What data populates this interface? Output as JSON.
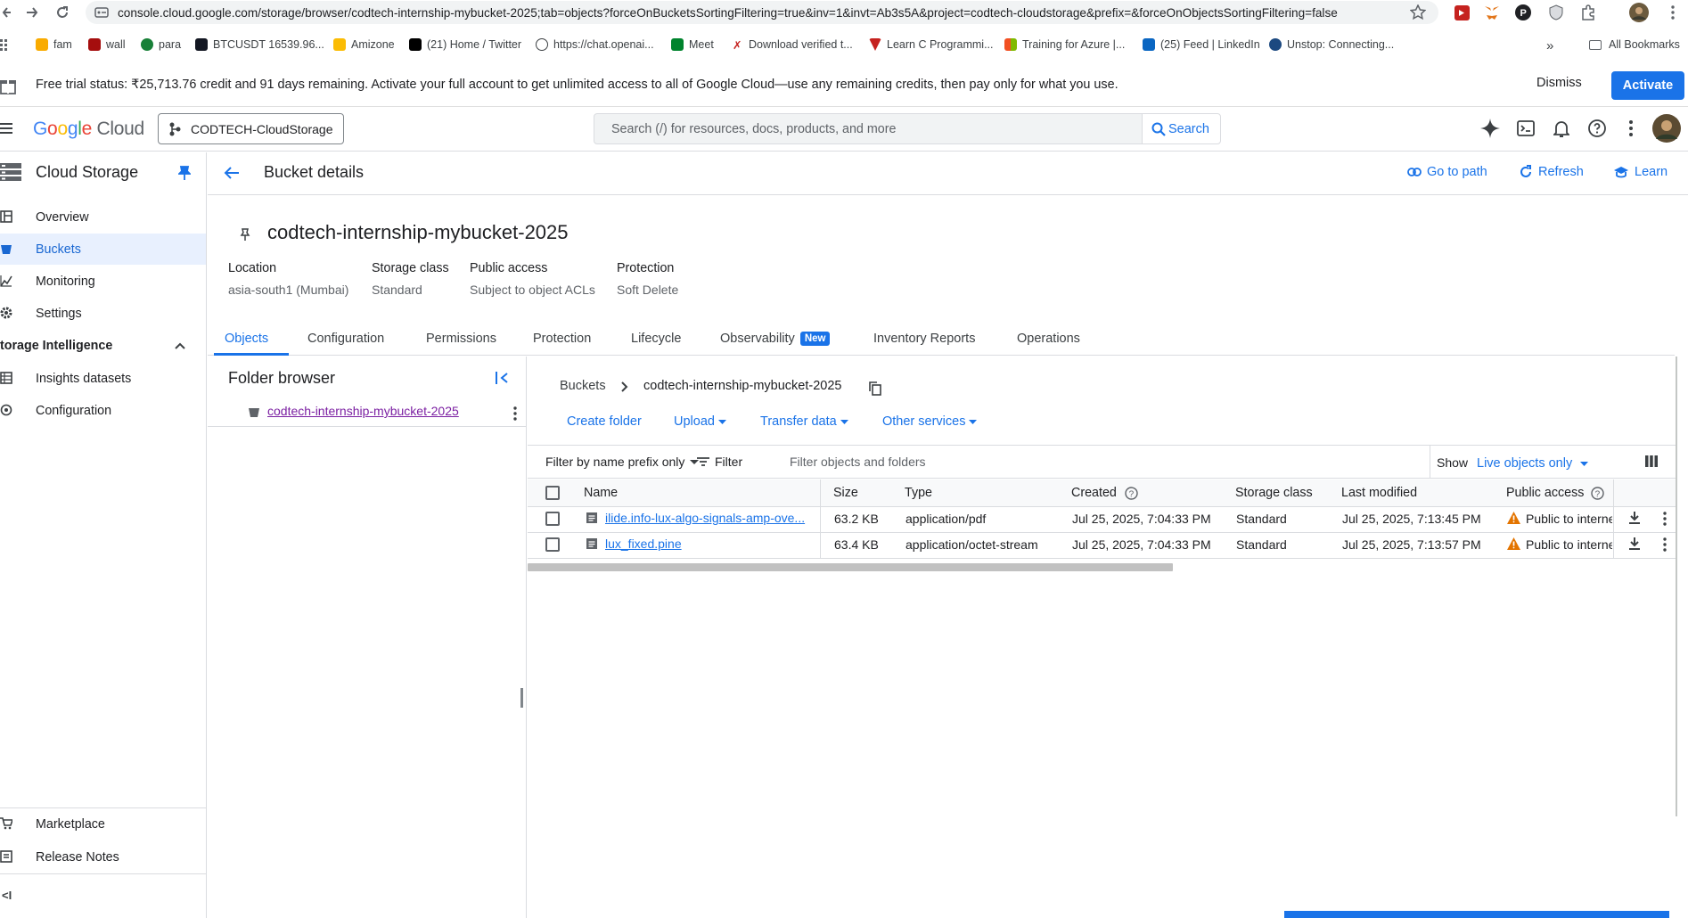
{
  "browser": {
    "url": "console.cloud.google.com/storage/browser/codtech-internship-mybucket-2025;tab=objects?forceOnBucketsSortingFiltering=true&inv=1&invt=Ab3s5A&project=codtech-cloudstorage&prefix=&forceOnObjectsSortingFiltering=false",
    "bookmarks": [
      "fam",
      "wall",
      "para",
      "BTCUSDT 16539.96...",
      "Amizone",
      "(21) Home / Twitter",
      "https://chat.openai...",
      "Meet",
      "Download verified t...",
      "Learn C Programmi...",
      "Training for Azure |...",
      "(25) Feed | LinkedIn",
      "Unstop: Connecting..."
    ],
    "all_bookmarks": "All Bookmarks",
    "more_chevron": "»"
  },
  "banner": {
    "text": "Free trial status: ₹25,713.76 credit and 91 days remaining. Activate your full account to get unlimited access to all of Google Cloud—use any remaining credits, then pay only for what you use.",
    "dismiss": "Dismiss",
    "activate": "Activate"
  },
  "header": {
    "logo_google": "Google",
    "logo_cloud": "Cloud",
    "project": "CODTECH-CloudStorage",
    "search_placeholder": "Search (/) for resources, docs, products, and more",
    "search_button": "Search"
  },
  "sidebar": {
    "title": "Cloud Storage",
    "items": [
      {
        "label": "Overview",
        "icon": "dashboard-icon"
      },
      {
        "label": "Buckets",
        "icon": "bucket-icon"
      },
      {
        "label": "Monitoring",
        "icon": "chart-icon"
      },
      {
        "label": "Settings",
        "icon": "gear-icon"
      }
    ],
    "section_title": "torage Intelligence",
    "section_items": [
      {
        "label": "Insights datasets",
        "icon": "dataset-icon"
      },
      {
        "label": "Configuration",
        "icon": "config-icon"
      }
    ],
    "bottom_items": [
      {
        "label": "Marketplace",
        "icon": "cart-icon"
      },
      {
        "label": "Release Notes",
        "icon": "notes-icon"
      }
    ],
    "collapse": "<I"
  },
  "page": {
    "title": "Bucket details",
    "go_to_path": "Go to path",
    "refresh": "Refresh",
    "learn": "Learn",
    "bucket_name": "codtech-internship-mybucket-2025",
    "meta": [
      {
        "key": "Location",
        "value": "asia-south1 (Mumbai)"
      },
      {
        "key": "Storage class",
        "value": "Standard"
      },
      {
        "key": "Public access",
        "value": "Subject to object ACLs"
      },
      {
        "key": "Protection",
        "value": "Soft Delete"
      }
    ],
    "tabs": [
      "Objects",
      "Configuration",
      "Permissions",
      "Protection",
      "Lifecycle",
      "Observability",
      "Inventory Reports",
      "Operations"
    ],
    "new_badge": "New",
    "active_tab": "Objects"
  },
  "folder_browser": {
    "title": "Folder browser",
    "bucket": "codtech-internship-mybucket-2025"
  },
  "objects": {
    "breadcrumb_root": "Buckets",
    "breadcrumb_current": "codtech-internship-mybucket-2025",
    "actions": [
      "Create folder",
      "Upload",
      "Transfer data",
      "Other services"
    ],
    "filter_mode": "Filter by name prefix only",
    "filter_label": "Filter",
    "filter_placeholder": "Filter objects and folders",
    "show_label": "Show",
    "show_value": "Live objects only",
    "columns": [
      "Name",
      "Size",
      "Type",
      "Created",
      "Storage class",
      "Last modified",
      "Public access"
    ],
    "rows": [
      {
        "name": "ilide.info-lux-algo-signals-amp-ove...",
        "size": "63.2 KB",
        "type": "application/pdf",
        "created": "Jul 25, 2025, 7:04:33 PM",
        "storage_class": "Standard",
        "last_modified": "Jul 25, 2025, 7:13:45 PM",
        "public_access": "Public to interne"
      },
      {
        "name": "lux_fixed.pine",
        "size": "63.4 KB",
        "type": "application/octet-stream",
        "created": "Jul 25, 2025, 7:04:33 PM",
        "storage_class": "Standard",
        "last_modified": "Jul 25, 2025, 7:13:57 PM",
        "public_access": "Public to interne"
      }
    ]
  },
  "colors": {
    "accent": "#1a73e8",
    "warning": "#e37400",
    "active_bg": "#e8f0fe"
  }
}
